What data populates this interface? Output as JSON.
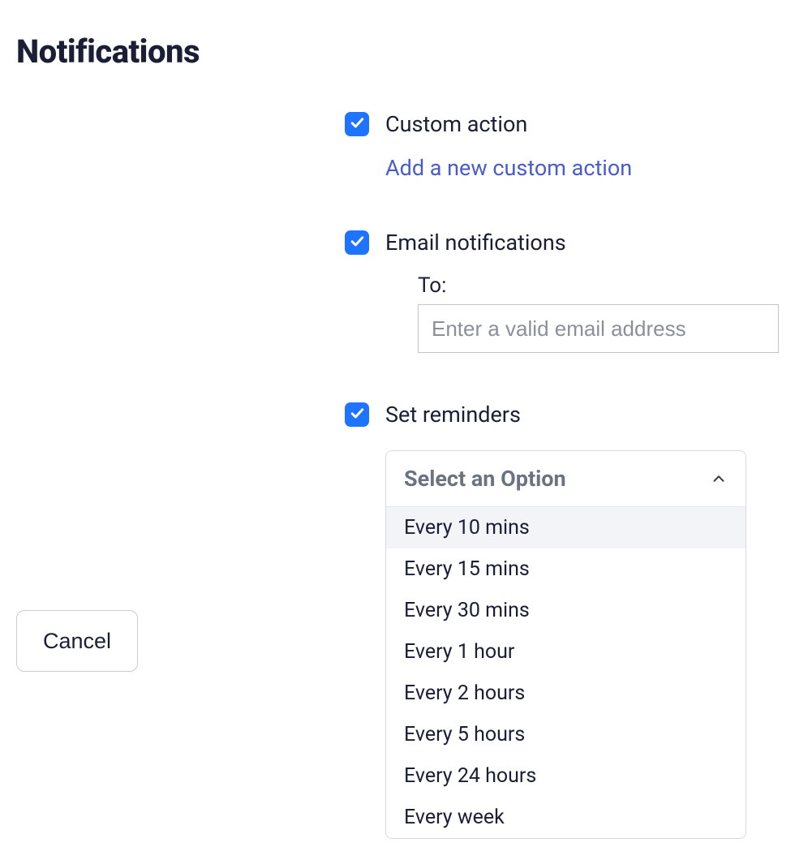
{
  "title": "Notifications",
  "custom_action": {
    "label": "Custom action",
    "add_link": "Add a new custom action"
  },
  "email_notifications": {
    "label": "Email notifications",
    "to_label": "To:",
    "placeholder": "Enter a valid email address",
    "value": ""
  },
  "reminders": {
    "label": "Set reminders",
    "select_placeholder": "Select an Option",
    "options": [
      "Every 10 mins",
      "Every 15 mins",
      "Every 30 mins",
      "Every 1 hour",
      "Every 2 hours",
      "Every 5 hours",
      "Every 24 hours",
      "Every week"
    ]
  },
  "cancel_label": "Cancel"
}
